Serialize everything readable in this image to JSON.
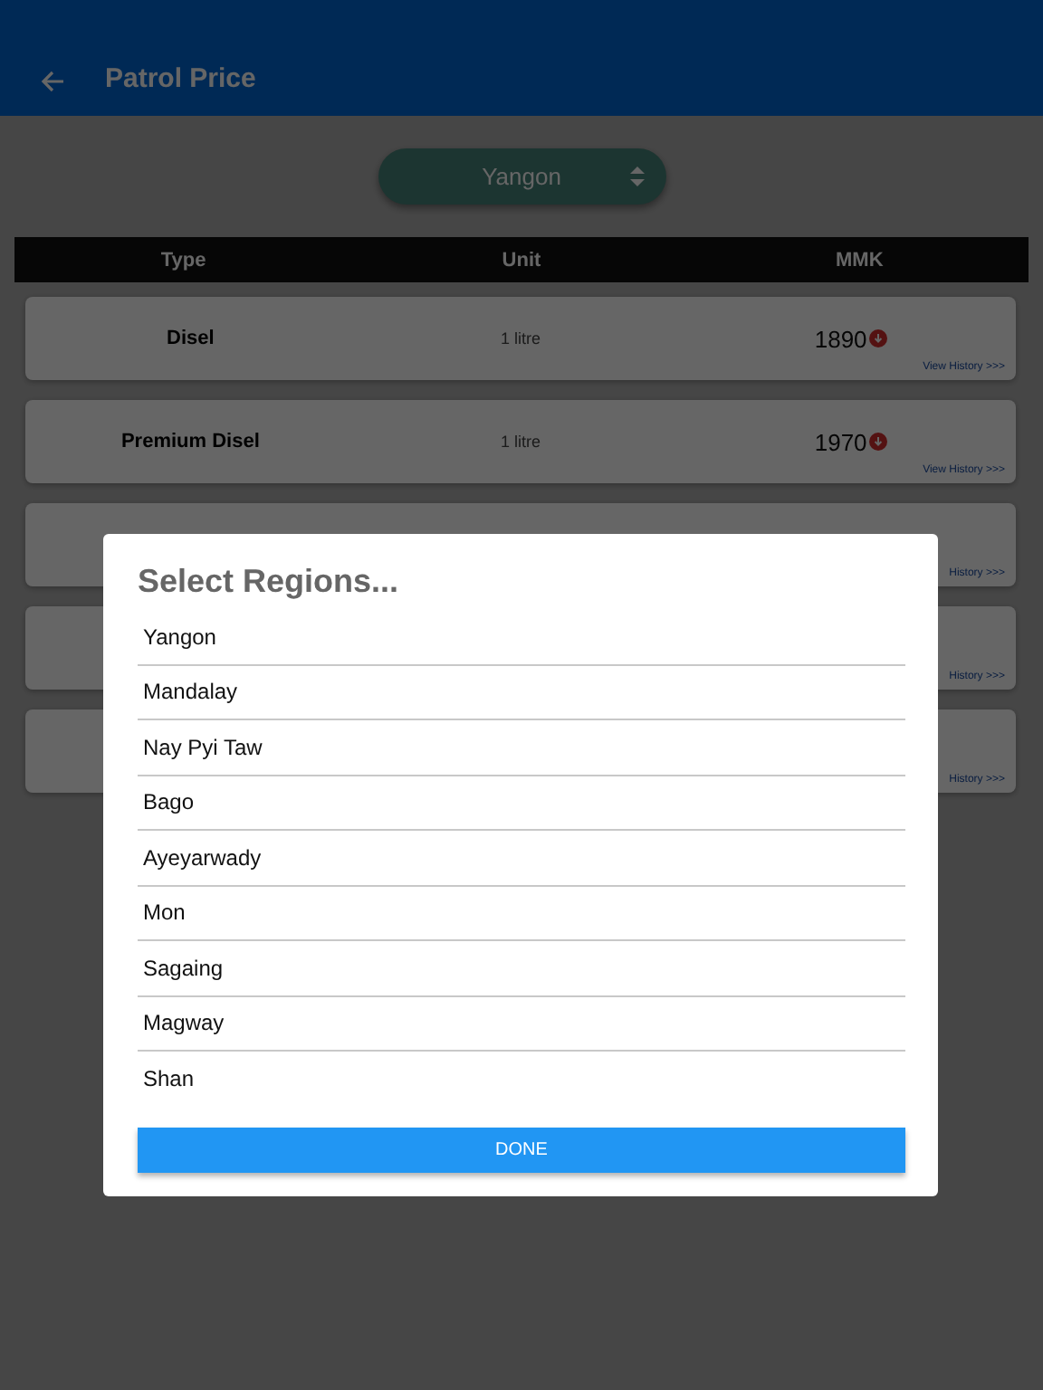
{
  "app_bar": {
    "title": "Patrol Price"
  },
  "region_picker": {
    "value": "Yangon"
  },
  "table": {
    "columns": [
      "Type",
      "Unit",
      "MMK"
    ],
    "rows": [
      {
        "type": "Disel",
        "unit": "1 litre",
        "price": "1890",
        "link": "View History >>>"
      },
      {
        "type": "Premium Disel",
        "unit": "1 litre",
        "price": "1970",
        "link": "View History >>>"
      },
      {
        "link": "History >>>"
      },
      {
        "link": "History >>>"
      },
      {
        "link": "History >>>"
      }
    ]
  },
  "dialog": {
    "title": "Select Regions...",
    "options": [
      "Yangon",
      "Mandalay",
      "Nay Pyi Taw",
      "Bago",
      "Ayeyarwady",
      "Mon",
      "Sagaing",
      "Magway",
      "Shan"
    ],
    "button": "DONE"
  }
}
